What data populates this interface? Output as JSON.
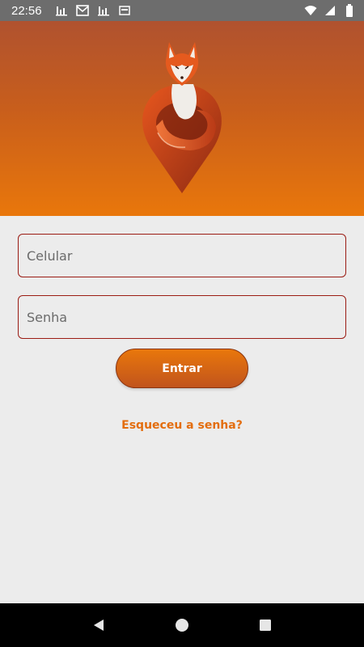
{
  "status_bar": {
    "time": "22:56",
    "left_icons": [
      "signal-bars-icon",
      "mail-icon",
      "signal-bars-icon",
      "card-icon"
    ],
    "right_icons": [
      "wifi-icon",
      "cell-signal-icon",
      "battery-icon"
    ]
  },
  "header": {
    "logo": "fox-location-pin-logo",
    "gradient_top": "#b0522f",
    "gradient_bottom": "#e9770b"
  },
  "login": {
    "phone_placeholder": "Celular",
    "password_placeholder": "Senha",
    "enter_label": "Entrar",
    "forgot_label": "Esqueceu a senha?"
  },
  "colors": {
    "accent": "#e36d0e",
    "field_border": "#9b1c14",
    "background": "#ececec"
  },
  "nav_bar": {
    "buttons": [
      "back-icon",
      "home-icon",
      "recents-icon"
    ]
  }
}
